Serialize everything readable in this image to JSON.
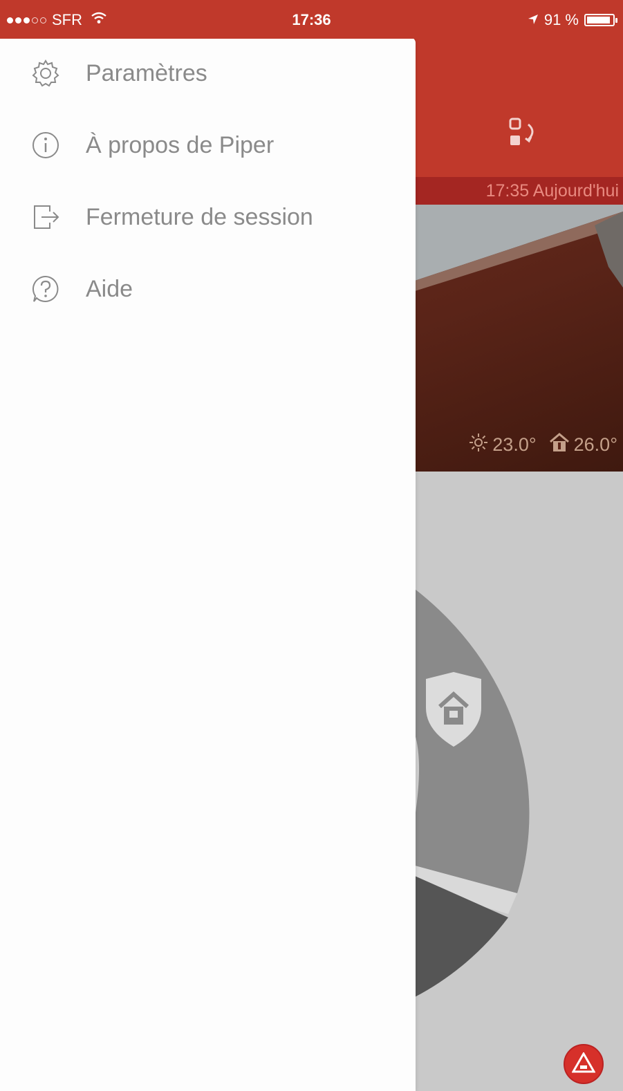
{
  "status_bar": {
    "carrier": "SFR",
    "time": "17:36",
    "battery": "91 %",
    "battery_level": 0.91
  },
  "camera": {
    "timestamp": "17:35 Aujourd'hui",
    "outdoor_temp": "23.0°",
    "indoor_temp": "26.0°"
  },
  "drawer": {
    "items": [
      {
        "label": "Paramètres",
        "icon": "gear-icon"
      },
      {
        "label": "À propos de Piper",
        "icon": "info-icon"
      },
      {
        "label": "Fermeture de session",
        "icon": "logout-icon"
      },
      {
        "label": "Aide",
        "icon": "help-icon"
      }
    ]
  },
  "colors": {
    "brand_red": "#c0392b",
    "drawer_bg": "#fdfdfd",
    "menu_text": "#8a8a8a"
  }
}
